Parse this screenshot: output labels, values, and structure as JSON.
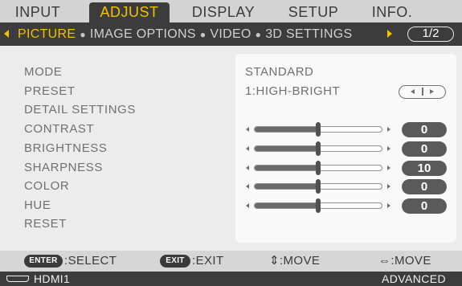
{
  "tabs": [
    {
      "label": "INPUT",
      "active": false
    },
    {
      "label": "ADJUST",
      "active": true
    },
    {
      "label": "DISPLAY",
      "active": false
    },
    {
      "label": "SETUP",
      "active": false
    },
    {
      "label": "INFO.",
      "active": false
    }
  ],
  "subnav": {
    "items": [
      "PICTURE",
      "IMAGE OPTIONS",
      "VIDEO",
      "3D SETTINGS"
    ],
    "active_index": 0,
    "page": "1/2"
  },
  "settings": {
    "mode": {
      "label": "MODE",
      "value": "STANDARD"
    },
    "preset": {
      "label": "PRESET",
      "value": "1:HIGH-BRIGHT"
    },
    "detail": {
      "label": "DETAIL SETTINGS"
    },
    "contrast": {
      "label": "CONTRAST",
      "value": "0",
      "level": 0.5
    },
    "brightness": {
      "label": "BRIGHTNESS",
      "value": "0",
      "level": 0.5
    },
    "sharpness": {
      "label": "SHARPNESS",
      "value": "10",
      "level": 0.5
    },
    "color": {
      "label": "COLOR",
      "value": "0",
      "level": 0.5
    },
    "hue": {
      "label": "HUE",
      "value": "0",
      "level": 0.5
    },
    "reset": {
      "label": "RESET"
    }
  },
  "footer": {
    "enter_key": "ENTER",
    "enter_text": ":SELECT",
    "exit_key": "EXIT",
    "exit_text": ":EXIT",
    "move_v": "⇕:MOVE",
    "move_h": "⇔:MOVE"
  },
  "status": {
    "source": "HDMI1",
    "mode": "ADVANCED",
    "source_icon": "hdmi-icon"
  },
  "colors": {
    "accent": "#f0c200",
    "dark": "#3c3c3c"
  }
}
